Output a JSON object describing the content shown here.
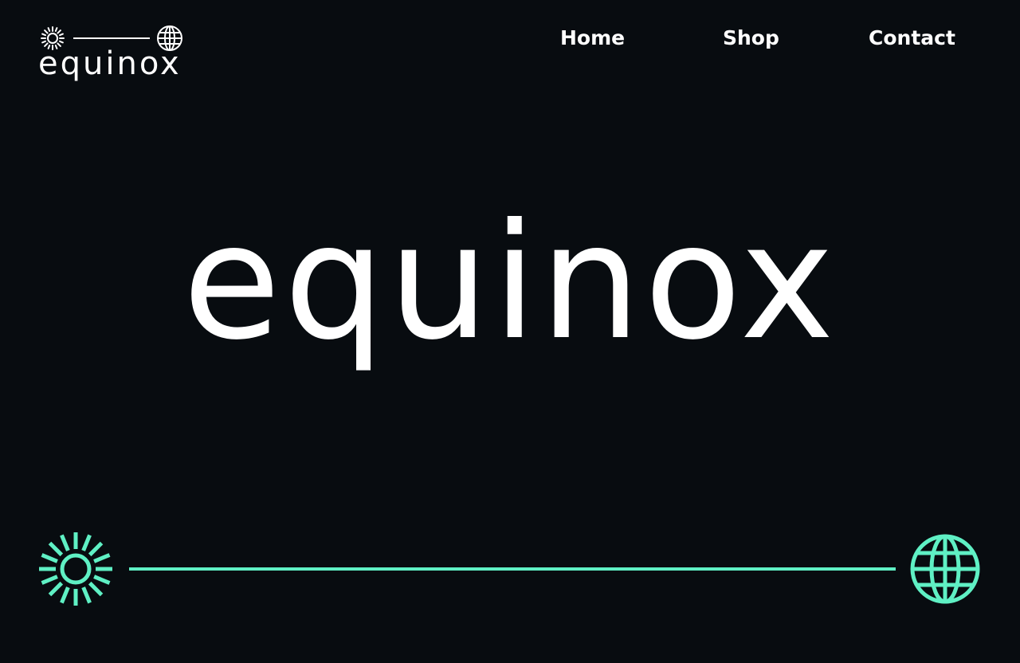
{
  "brand": {
    "logo_text": "equinox",
    "accent_color": "#5ff0c4",
    "icons": [
      "sun-icon",
      "globe-icon"
    ]
  },
  "nav": {
    "items": [
      {
        "label": "Home"
      },
      {
        "label": "Shop"
      },
      {
        "label": "Contact"
      }
    ]
  },
  "hero": {
    "title": "equinox"
  },
  "colors": {
    "background": "#080c10",
    "text": "#ffffff",
    "accent": "#5ff0c4"
  }
}
